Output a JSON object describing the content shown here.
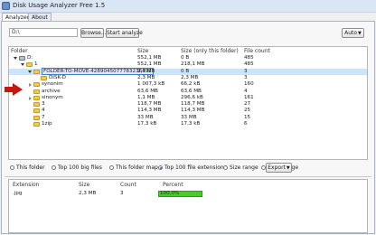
{
  "window": {
    "title": "Disk Usage Analyzer Free 1.5"
  },
  "tabs": [
    {
      "label": "Analyzer"
    },
    {
      "label": "About"
    }
  ],
  "toolbar": {
    "path_value": "D:\\",
    "browse_label": "Browse...",
    "start_label": "Start analyze",
    "auto_label": "Auto"
  },
  "tree": {
    "columns": [
      "Folder",
      "Size",
      "Size (only this folder)",
      "File count"
    ],
    "rows": [
      {
        "name": "D:",
        "size": "552,1 MB",
        "own": "0 B",
        "count": "485"
      },
      {
        "name": "1",
        "size": "552,1 MB",
        "own": "218,1 MB",
        "count": "485"
      },
      {
        "name": "FOLDER-TO-MOVE-4289045077783236492",
        "size": "2,3 MB",
        "own": "0 B",
        "count": "3"
      },
      {
        "name": "DISK-D",
        "size": "2,3 MB",
        "own": "2,3 MB",
        "count": "3"
      },
      {
        "name": "synonim",
        "size": "1 007,3 kB",
        "own": "66,2 kB",
        "count": "160"
      },
      {
        "name": "archive",
        "size": "63,6 MB",
        "own": "63,6 MB",
        "count": "4"
      },
      {
        "name": "sinonym",
        "size": "1,1 MB",
        "own": "296,6 kB",
        "count": "161"
      },
      {
        "name": "3",
        "size": "118,7 MB",
        "own": "118,7 MB",
        "count": "27"
      },
      {
        "name": "4",
        "size": "114,3 MB",
        "own": "114,3 MB",
        "count": "25"
      },
      {
        "name": "7",
        "size": "33 MB",
        "own": "33 MB",
        "count": "15"
      },
      {
        "name": "1zip",
        "size": "17,3 kB",
        "own": "17,3 kB",
        "count": "6"
      }
    ]
  },
  "views": [
    {
      "label": "This folder",
      "selected": false
    },
    {
      "label": "Top 100 big files",
      "selected": false
    },
    {
      "label": "This folder map",
      "selected": false
    },
    {
      "label": "Top 100 file extension",
      "selected": true
    },
    {
      "label": "Size range",
      "selected": false
    },
    {
      "label": "Time range",
      "selected": false
    }
  ],
  "export_label": "Export",
  "extensions": {
    "columns": [
      "Extension",
      "Size",
      "Count",
      "Percent"
    ],
    "rows": [
      {
        "ext": ".jpg",
        "size": "2,3 MB",
        "count": "3",
        "percent": "100,0%",
        "percent_value": 100
      }
    ]
  },
  "colors": {
    "highlight": "#cce4f7",
    "folder": "#f3c94f",
    "arrow": "#c9140f",
    "percent_bar": "#49cc2a"
  }
}
